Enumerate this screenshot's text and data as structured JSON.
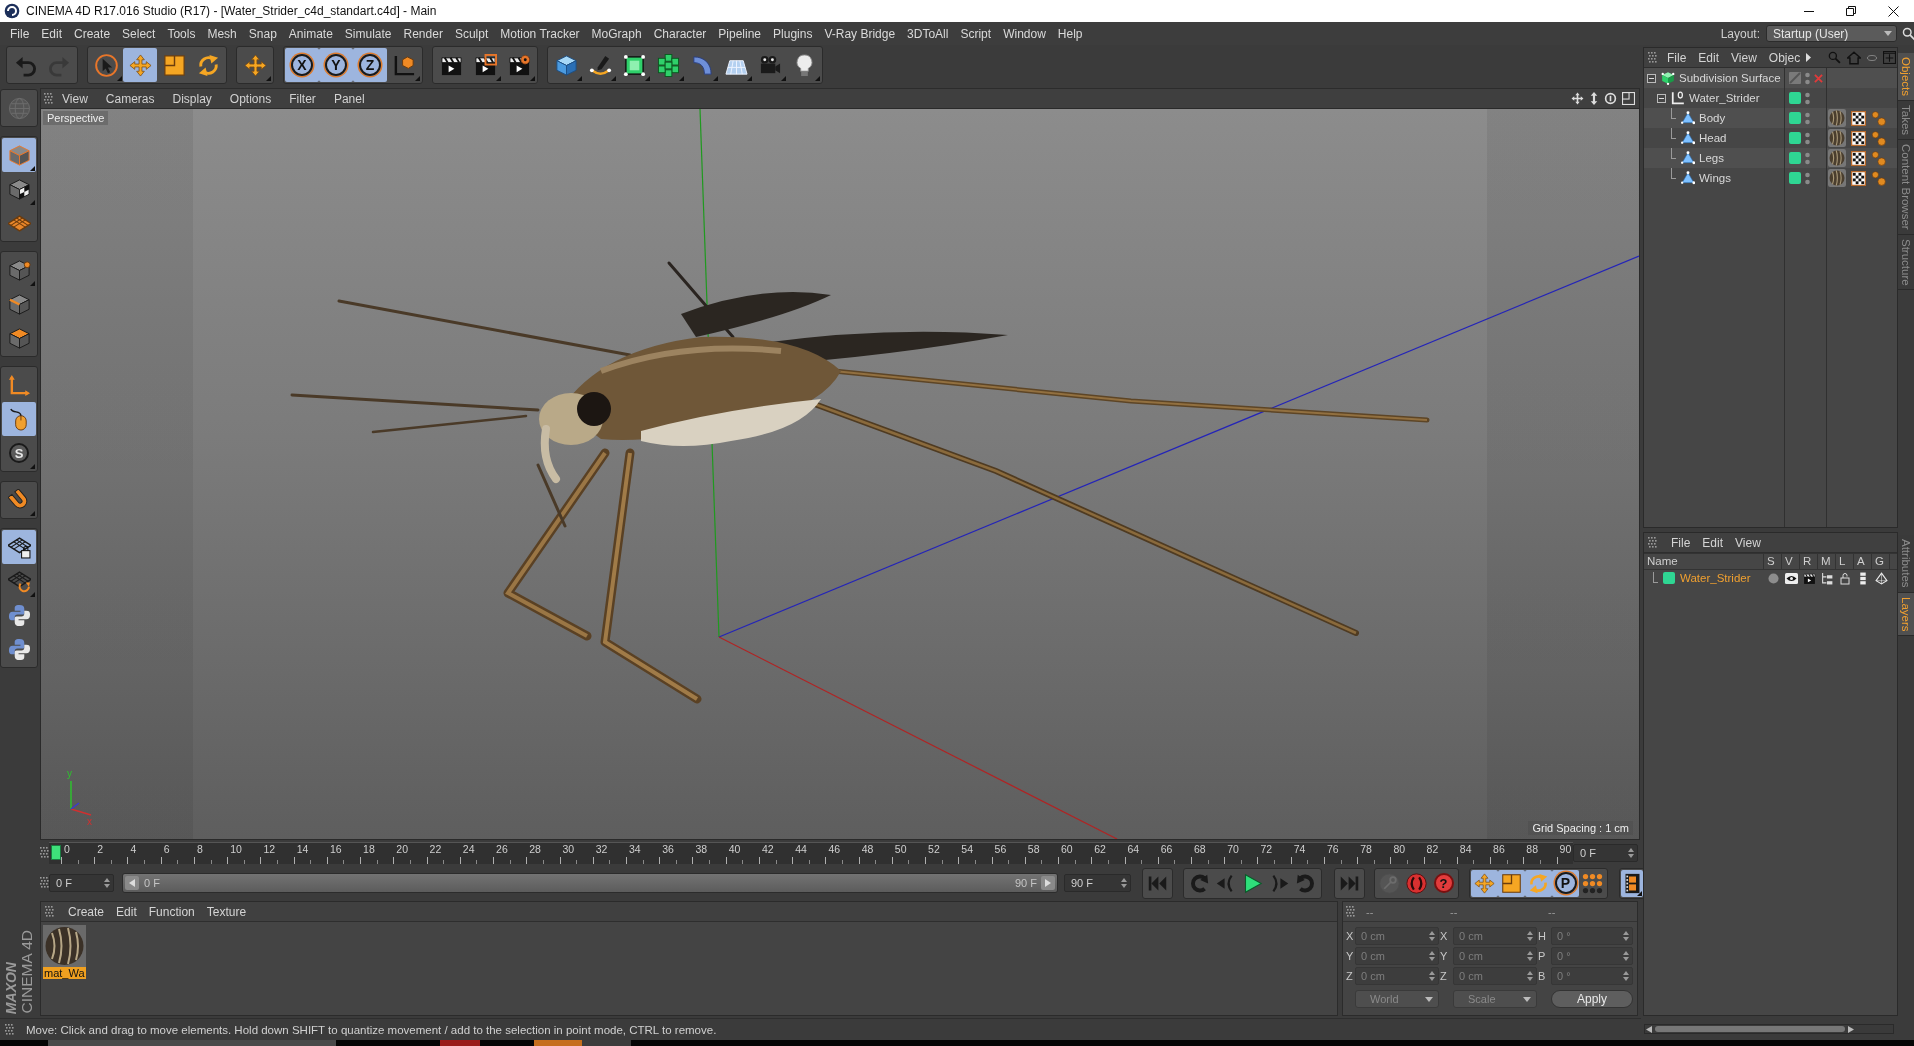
{
  "window": {
    "title": "CINEMA 4D R17.016 Studio (R17) - [Water_Strider_c4d_standart.c4d] - Main"
  },
  "menu_bar": {
    "items": [
      "File",
      "Edit",
      "Create",
      "Select",
      "Tools",
      "Mesh",
      "Snap",
      "Animate",
      "Simulate",
      "Render",
      "Sculpt",
      "Motion Tracker",
      "MoGraph",
      "Character",
      "Pipeline",
      "Plugins",
      "V-Ray Bridge",
      "3DToAll",
      "Script",
      "Window",
      "Help"
    ],
    "layout_label": "Layout:",
    "layout_value": "Startup (User)"
  },
  "toolbar": {
    "groups": [
      {
        "items": [
          {
            "kind": "undo",
            "disabled": false
          },
          {
            "kind": "redo",
            "disabled": true
          }
        ]
      },
      {
        "items": [
          {
            "kind": "select",
            "selected": false
          },
          {
            "kind": "move",
            "selected": true
          },
          {
            "kind": "scale",
            "selected": false
          },
          {
            "kind": "rotate",
            "selected": false
          }
        ]
      },
      {
        "items": [
          {
            "kind": "recent",
            "selected": false
          }
        ]
      },
      {
        "items": [
          {
            "kind": "axis",
            "label": "X",
            "selected": true
          },
          {
            "kind": "axis",
            "label": "Y",
            "selected": true
          },
          {
            "kind": "axis",
            "label": "Z",
            "selected": true
          },
          {
            "kind": "coords",
            "selected": false
          }
        ]
      },
      {
        "items": [
          {
            "kind": "renderview",
            "selected": false
          },
          {
            "kind": "renderregion",
            "selected": false
          },
          {
            "kind": "rendersettings",
            "selected": false
          }
        ]
      },
      {
        "items": [
          {
            "kind": "cube",
            "selected": false
          },
          {
            "kind": "pen",
            "selected": false
          },
          {
            "kind": "subdivision",
            "selected": false
          },
          {
            "kind": "cloner",
            "selected": false
          },
          {
            "kind": "deformer",
            "selected": false
          },
          {
            "kind": "floor",
            "selected": false
          },
          {
            "kind": "camera",
            "selected": false
          },
          {
            "kind": "light",
            "selected": false
          }
        ]
      }
    ]
  },
  "tool_palette": {
    "groups": [
      {
        "items": [
          {
            "kind": "solo",
            "disabled": true
          }
        ]
      },
      {
        "items": [
          {
            "kind": "model",
            "selected": true
          },
          {
            "kind": "texture",
            "selected": false
          },
          {
            "kind": "workplane",
            "selected": false
          }
        ]
      },
      {
        "items": [
          {
            "kind": "points",
            "selected": false
          },
          {
            "kind": "edges",
            "selected": false
          },
          {
            "kind": "polygons",
            "selected": false
          }
        ]
      },
      {
        "items": [
          {
            "kind": "axismode",
            "selected": false
          },
          {
            "kind": "tweak",
            "selected": true
          },
          {
            "kind": "snap",
            "label": "S",
            "selected": false
          }
        ]
      },
      {
        "items": [
          {
            "kind": "magnet",
            "selected": false
          }
        ]
      },
      {
        "items": [
          {
            "kind": "planelock",
            "selected": true
          },
          {
            "kind": "planealign",
            "selected": false
          },
          {
            "kind": "python",
            "selected": false
          },
          {
            "kind": "python",
            "selected": false
          }
        ]
      }
    ]
  },
  "viewport": {
    "menu": [
      "View",
      "Cameras",
      "Display",
      "Options",
      "Filter",
      "Panel"
    ],
    "camera": "Perspective",
    "grid_spacing": "Grid Spacing : 1 cm",
    "gizmo_labels": [
      "y",
      "x"
    ]
  },
  "timeline": {
    "ticks": [
      "0",
      "2",
      "4",
      "6",
      "8",
      "10",
      "12",
      "14",
      "16",
      "18",
      "20",
      "22",
      "24",
      "26",
      "28",
      "30",
      "32",
      "34",
      "36",
      "38",
      "40",
      "42",
      "44",
      "46",
      "48",
      "50",
      "52",
      "54",
      "56",
      "58",
      "60",
      "62",
      "64",
      "66",
      "68",
      "70",
      "72",
      "74",
      "76",
      "78",
      "80",
      "82",
      "84",
      "86",
      "88",
      "90"
    ],
    "playhead": {
      "level": 0
    },
    "current_frame": "0 F",
    "start_field": "0 F",
    "range": {
      "start": "0 F",
      "end": "90 F",
      "level": 1
    },
    "end_field": "90 F",
    "groups": [
      {
        "items": [
          {
            "kind": "start"
          }
        ]
      },
      {
        "items": [
          {
            "kind": "prevkey"
          },
          {
            "kind": "prevframe"
          },
          {
            "kind": "play"
          },
          {
            "kind": "nextframe"
          },
          {
            "kind": "nextkey"
          }
        ]
      },
      {
        "items": [
          {
            "kind": "end"
          }
        ]
      },
      {
        "items": [
          {
            "kind": "key",
            "disabled": true
          },
          {
            "kind": "autokey",
            "disabled": false
          },
          {
            "kind": "help",
            "label": "?",
            "disabled": false
          }
        ]
      },
      {
        "items": [
          {
            "kind": "move",
            "selected": true
          },
          {
            "kind": "scale",
            "selected": true
          },
          {
            "kind": "rotate",
            "selected": true
          },
          {
            "kind": "param",
            "label": "P",
            "selected": true
          },
          {
            "kind": "pla",
            "selected": false
          }
        ]
      },
      {
        "items": [
          {
            "kind": "film",
            "selected": true
          }
        ]
      }
    ]
  },
  "material_manager": {
    "menu": [
      "Create",
      "Edit",
      "Function",
      "Texture"
    ],
    "materials": [
      {
        "name": "mat_Wa",
        "selected": true
      }
    ]
  },
  "coordinates": {
    "headers": [
      "--",
      "--",
      "--"
    ],
    "rows": [
      {
        "fields": [
          {
            "axis": "X",
            "value": "0 cm"
          },
          {
            "axis": "X",
            "value": "0 cm"
          },
          {
            "axis": "H",
            "value": "0 °"
          }
        ]
      },
      {
        "fields": [
          {
            "axis": "Y",
            "value": "0 cm"
          },
          {
            "axis": "Y",
            "value": "0 cm"
          },
          {
            "axis": "P",
            "value": "0 °"
          }
        ]
      },
      {
        "fields": [
          {
            "axis": "Z",
            "value": "0 cm"
          },
          {
            "axis": "Z",
            "value": "0 cm"
          },
          {
            "axis": "B",
            "value": "0 °"
          }
        ]
      }
    ],
    "dropdowns": [
      "World",
      "Scale"
    ],
    "apply": "Apply"
  },
  "status_bar": {
    "text": "Move: Click and drag to move elements. Hold down SHIFT to quantize movement / add to the selection in point mode, CTRL to remove."
  },
  "logo": {
    "brand": "MAXON",
    "product": "CINEMA 4D"
  },
  "object_manager": {
    "menu": [
      "File",
      "Edit",
      "View",
      "Objec"
    ],
    "tree": [
      {
        "name": "Subdivision Surface",
        "kind": "generator",
        "enabled": false,
        "expanded": true,
        "children": [
          {
            "name": "Water_Strider",
            "kind": "null",
            "expanded": true,
            "children": [
              {
                "name": "Body",
                "kind": "polygon"
              },
              {
                "name": "Head",
                "kind": "polygon"
              },
              {
                "name": "Legs",
                "kind": "polygon"
              },
              {
                "name": "Wings",
                "kind": "polygon"
              }
            ]
          }
        ]
      }
    ]
  },
  "layer_manager": {
    "menu": [
      "File",
      "Edit",
      "View"
    ],
    "columns": [
      "Name",
      "S",
      "V",
      "R",
      "M",
      "L",
      "A",
      "G"
    ],
    "layers": [
      {
        "name": "Water_Strider",
        "color": "#2fd693",
        "selected": true
      }
    ]
  },
  "side_tabs": {
    "upper": [
      {
        "label": "Objects",
        "selected": true
      },
      {
        "label": "Takes",
        "selected": false
      },
      {
        "label": "Content Browser",
        "selected": false
      },
      {
        "label": "Structure",
        "selected": false
      }
    ],
    "lower": [
      {
        "label": "Attributes",
        "selected": false
      },
      {
        "label": "Layers",
        "selected": true
      }
    ]
  }
}
